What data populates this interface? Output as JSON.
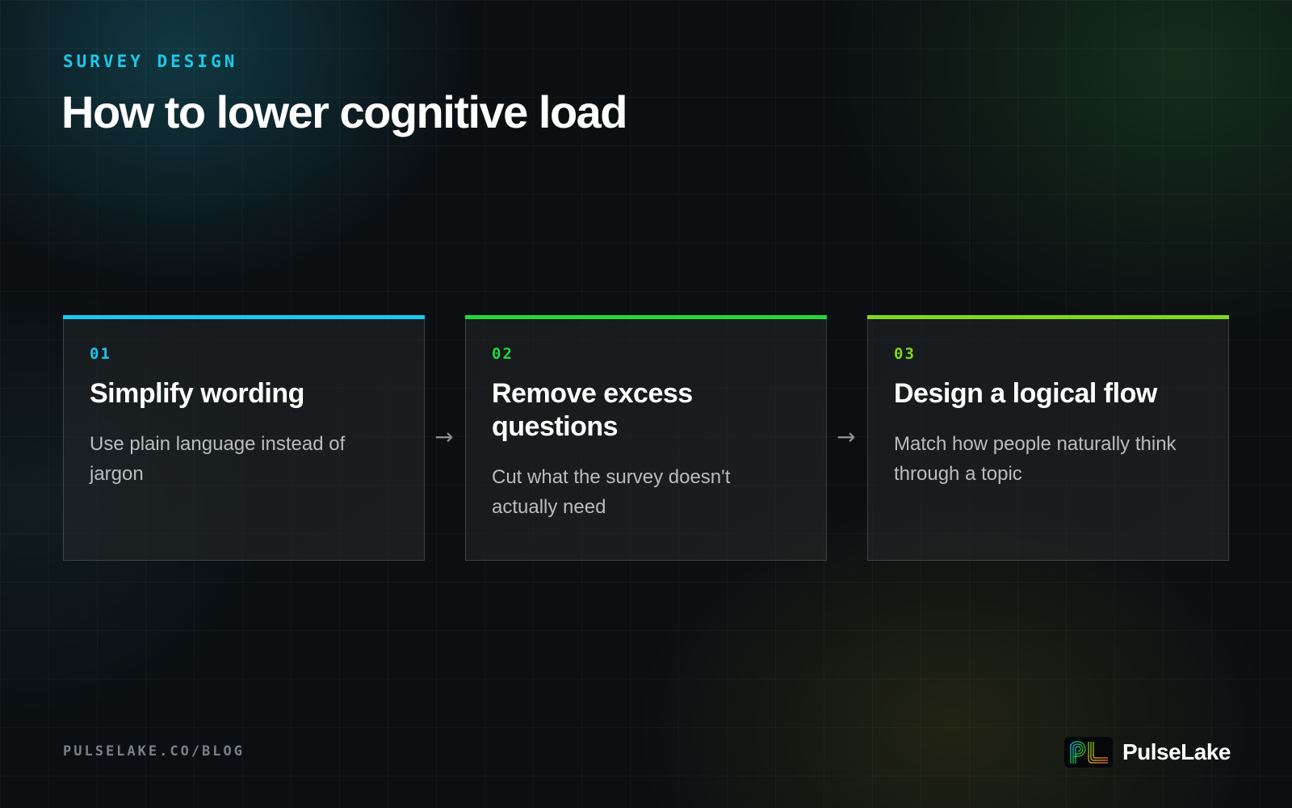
{
  "eyebrow": "SURVEY DESIGN",
  "title": "How to lower cognitive load",
  "steps": [
    {
      "number": "01",
      "title": "Simplify wording",
      "description": "Use plain language instead of jargon",
      "accent_color": "#1cc8f0"
    },
    {
      "number": "02",
      "title": "Remove excess questions",
      "description": "Cut what the survey doesn't actually need",
      "accent_color": "#22d83a"
    },
    {
      "number": "03",
      "title": "Design a logical flow",
      "description": "Match how people naturally think through a topic",
      "accent_color": "#7fd81f"
    }
  ],
  "arrow_glyph": "→",
  "footer": {
    "url": "PULSELAKE.CO/BLOG"
  },
  "brand": {
    "name": "PulseLake",
    "logo_text": "PL",
    "logo_icon": "pulselake-logo-icon"
  }
}
